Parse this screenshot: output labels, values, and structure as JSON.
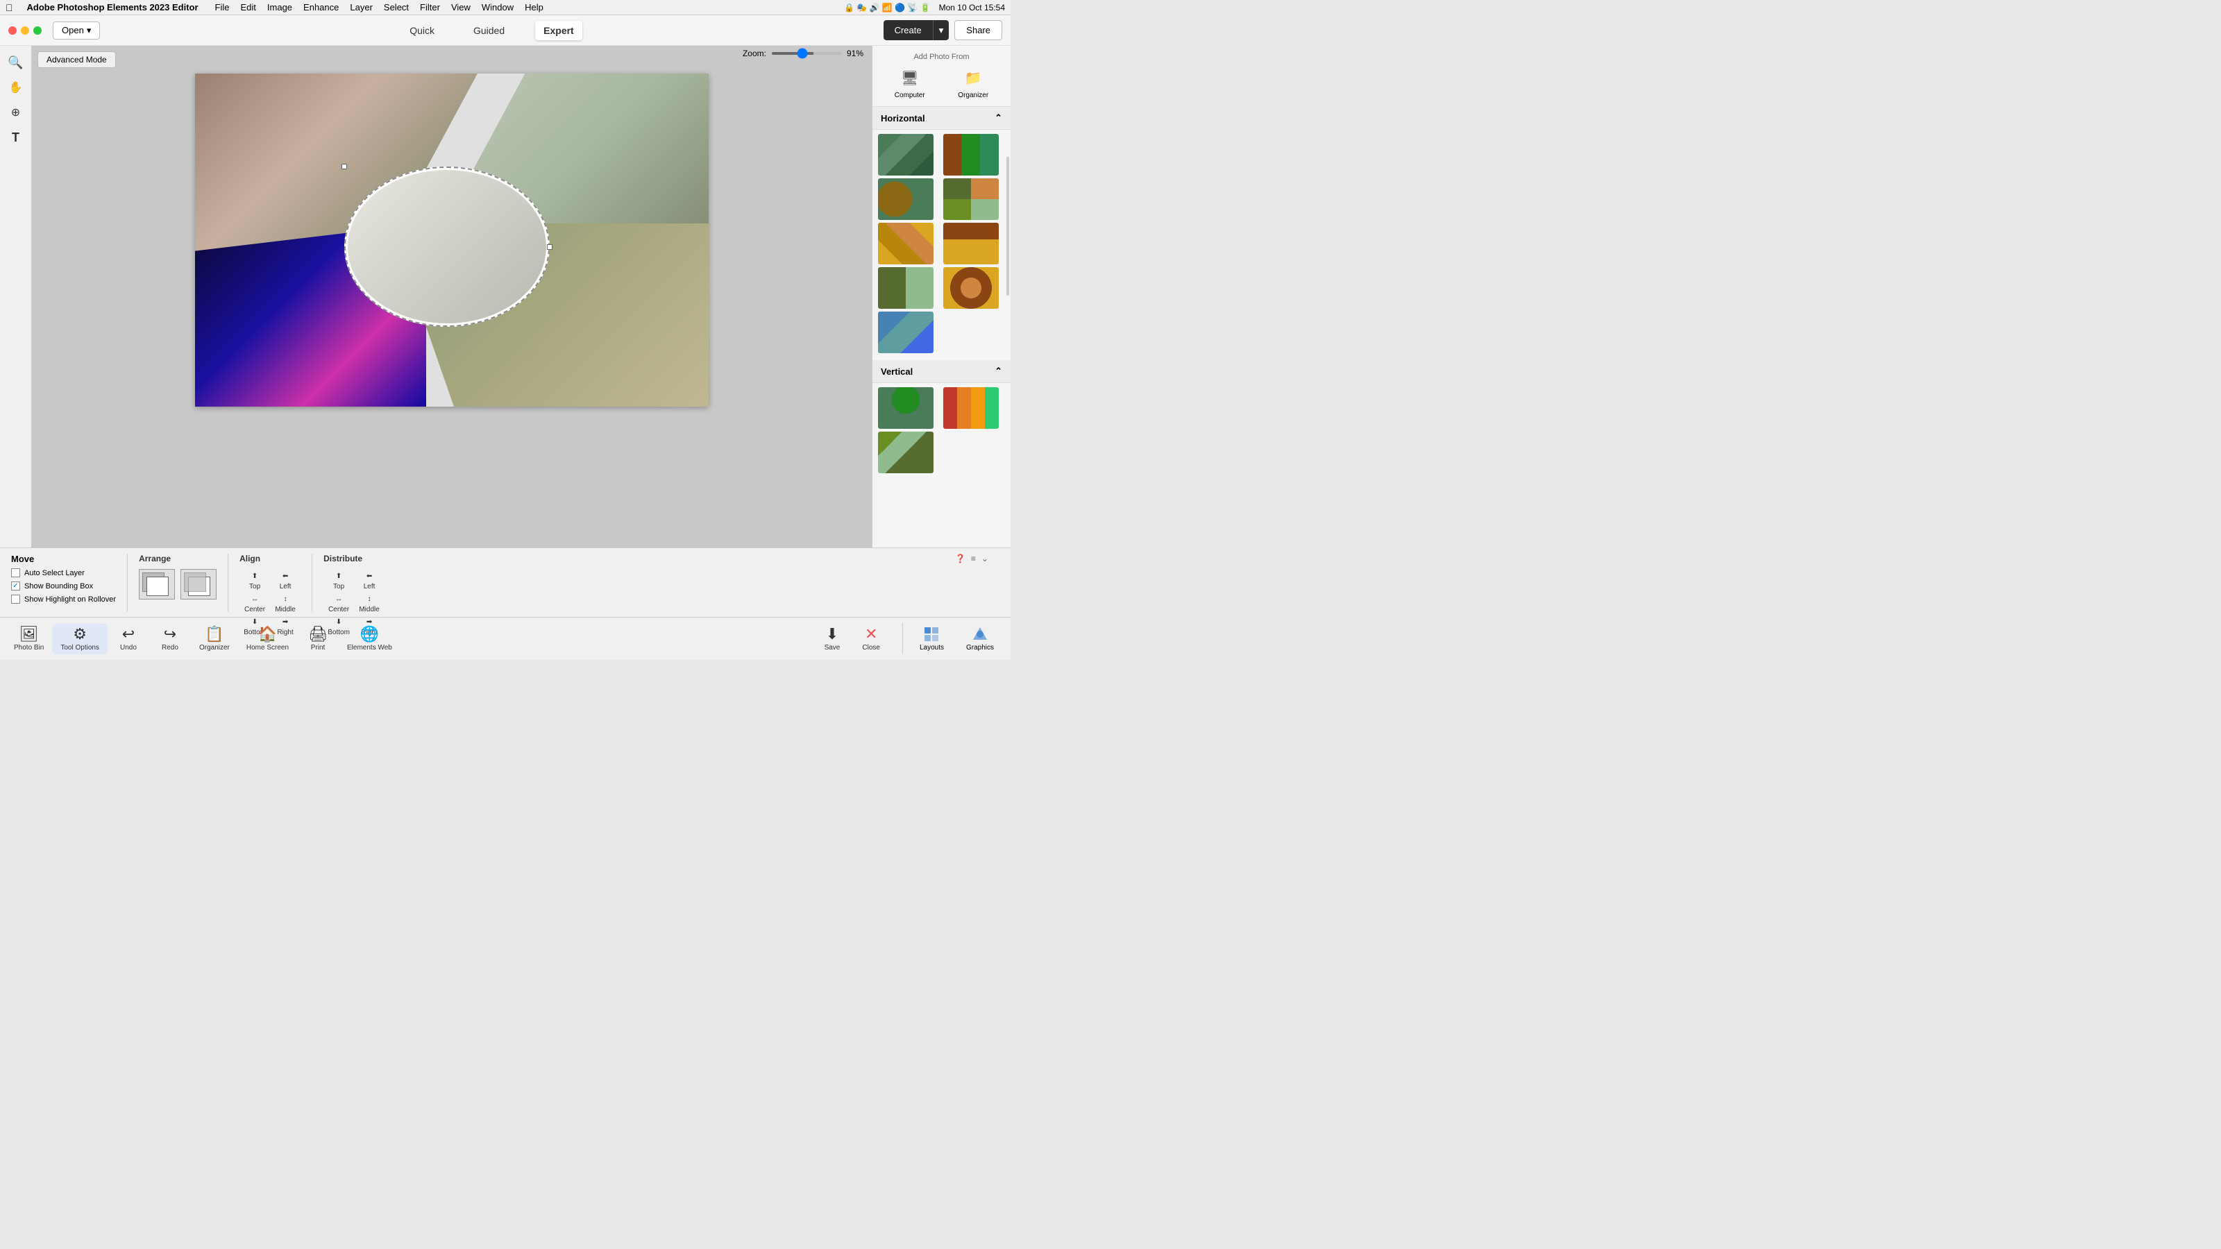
{
  "app": {
    "name": "Adobe Photoshop Elements 2023 Editor",
    "date": "Mon 10 Oct  15:54"
  },
  "menu": {
    "items": [
      "File",
      "Edit",
      "Image",
      "Enhance",
      "Layer",
      "Select",
      "Filter",
      "View",
      "Window",
      "Help"
    ]
  },
  "toolbar": {
    "open_label": "Open",
    "modes": [
      "Quick",
      "Guided",
      "Expert"
    ],
    "active_mode": "Expert",
    "create_label": "Create",
    "share_label": "Share",
    "advanced_mode_label": "Advanced Mode"
  },
  "zoom": {
    "label": "Zoom:",
    "value": "91%",
    "level": 91
  },
  "right_panel": {
    "add_photo_label": "Add Photo From",
    "computer_label": "Computer",
    "organizer_label": "Organizer",
    "horizontal_label": "Horizontal",
    "vertical_label": "Vertical",
    "layouts": [
      {
        "id": 1,
        "class": "lt-1"
      },
      {
        "id": 2,
        "class": "lt-2"
      },
      {
        "id": 3,
        "class": "lt-3"
      },
      {
        "id": 4,
        "class": "lt-4"
      },
      {
        "id": 5,
        "class": "lt-5"
      },
      {
        "id": 6,
        "class": "lt-6"
      },
      {
        "id": 7,
        "class": "lt-7"
      },
      {
        "id": 8,
        "class": "lt-8"
      },
      {
        "id": 9,
        "class": "lt-9"
      },
      {
        "id": 10,
        "class": "lt-10"
      },
      {
        "id": 11,
        "class": "lt-11"
      }
    ]
  },
  "bottom_options": {
    "move_label": "Move",
    "auto_select_layer_label": "Auto Select Layer",
    "show_bounding_box_label": "Show Bounding Box",
    "show_highlight_label": "Show Highlight on Rollover",
    "auto_select_checked": false,
    "bounding_box_checked": true,
    "highlight_checked": false,
    "arrange_label": "Arrange",
    "align_label": "Align",
    "distribute_label": "Distribute",
    "align_items": [
      {
        "label": "Top",
        "row": 1,
        "col": 1
      },
      {
        "label": "Left",
        "row": 1,
        "col": 2
      },
      {
        "label": "Center",
        "row": 2,
        "col": 1
      },
      {
        "label": "Middle",
        "row": 2,
        "col": 2
      },
      {
        "label": "Bottom",
        "row": 3,
        "col": 1
      },
      {
        "label": "Right",
        "row": 3,
        "col": 2
      }
    ],
    "distribute_items": [
      {
        "label": "Top",
        "row": 1,
        "col": 1
      },
      {
        "label": "Left",
        "row": 1,
        "col": 2
      },
      {
        "label": "Center",
        "row": 2,
        "col": 1
      },
      {
        "label": "Middle",
        "row": 2,
        "col": 2
      },
      {
        "label": "Bottom",
        "row": 3,
        "col": 1
      },
      {
        "label": "Right",
        "row": 3,
        "col": 2
      }
    ]
  },
  "taskbar": {
    "items": [
      {
        "id": "photo-bin",
        "label": "Photo Bin",
        "icon": "🖼"
      },
      {
        "id": "tool-options",
        "label": "Tool Options",
        "icon": "⚙"
      },
      {
        "id": "undo",
        "label": "Undo",
        "icon": "↩"
      },
      {
        "id": "redo",
        "label": "Redo",
        "icon": "↪"
      },
      {
        "id": "organizer",
        "label": "Organizer",
        "icon": "📋"
      },
      {
        "id": "home-screen",
        "label": "Home Screen",
        "icon": "🏠"
      },
      {
        "id": "print",
        "label": "Print",
        "icon": "🖨"
      },
      {
        "id": "elements-web",
        "label": "Elements Web",
        "icon": "🌐"
      }
    ],
    "save_label": "Save",
    "close_label": "Close",
    "layouts_label": "Layouts",
    "graphics_label": "Graphics"
  }
}
